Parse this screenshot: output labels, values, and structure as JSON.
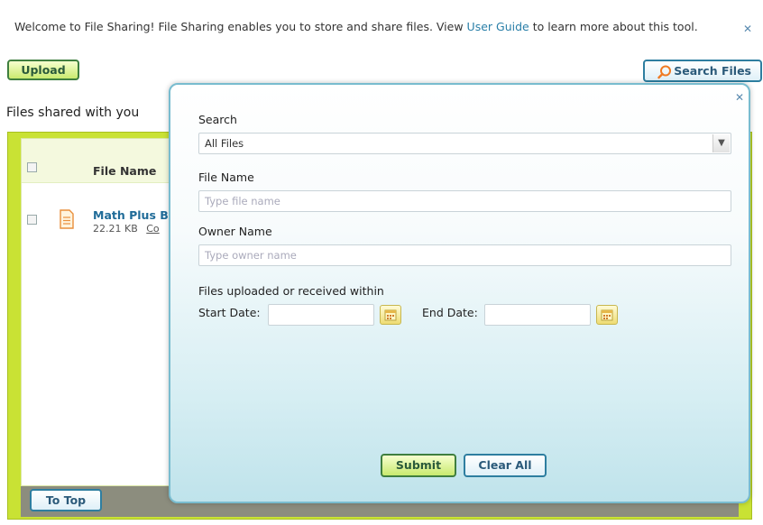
{
  "welcome": {
    "text_before": "Welcome to File Sharing! File Sharing enables you to store and share files. View ",
    "link": "User Guide",
    "text_after": " to learn more about this tool."
  },
  "toolbar": {
    "upload_label": "Upload",
    "search_files_label": "Search Files"
  },
  "section": {
    "title": "Files shared with you"
  },
  "files_table": {
    "column_header": "File Name",
    "rows": [
      {
        "name": "Math Plus Bl",
        "size": "22.21 KB",
        "link": "Co"
      }
    ]
  },
  "footer": {
    "to_top_label": "To Top"
  },
  "search_modal": {
    "search_label": "Search",
    "search_value": "All Files",
    "file_name_label": "File Name",
    "file_name_placeholder": "Type file name",
    "owner_name_label": "Owner Name",
    "owner_name_placeholder": "Type owner name",
    "date_range_label": "Files uploaded or received within",
    "start_date_label": "Start Date:",
    "end_date_label": "End Date:",
    "submit_label": "Submit",
    "clear_all_label": "Clear All"
  }
}
